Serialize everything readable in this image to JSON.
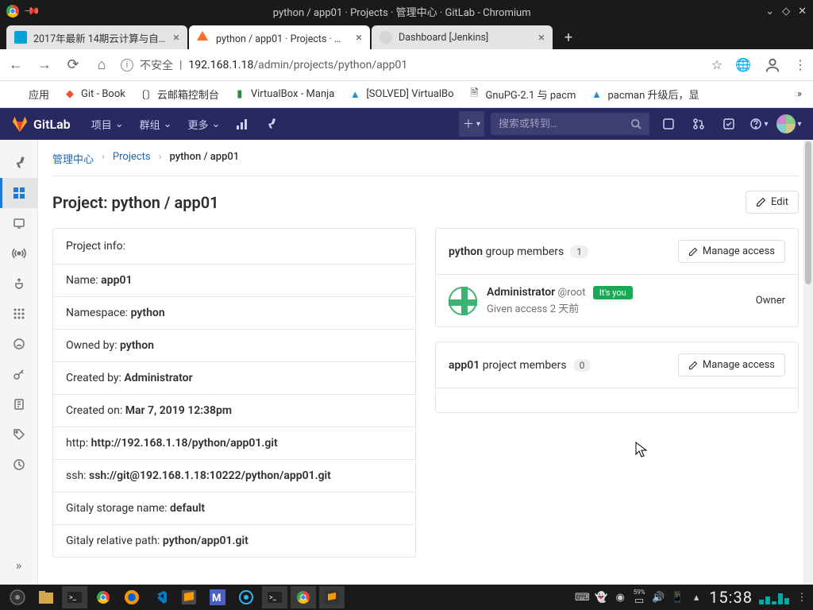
{
  "window": {
    "title": "python / app01 · Projects · 管理中心 · GitLab - Chromium"
  },
  "browser_tabs": [
    {
      "label": "2017年最新 14期云计算与自动",
      "active": false,
      "kind": "bili"
    },
    {
      "label": "python / app01 · Projects · 管理",
      "active": true,
      "kind": "gitlab"
    },
    {
      "label": "Dashboard [Jenkins]",
      "active": false,
      "kind": "jenkins"
    }
  ],
  "url": {
    "insecure_label": "不安全",
    "host": "192.168.1.18",
    "path": "/admin/projects/python/app01"
  },
  "bookmarks": [
    {
      "label": "应用",
      "icon": "apps"
    },
    {
      "label": "Git - Book",
      "icon": "git"
    },
    {
      "label": "云邮箱控制台",
      "icon": "mail"
    },
    {
      "label": "VirtualBox - Manja",
      "icon": "vbox"
    },
    {
      "label": "[SOLVED] VirtualBo",
      "icon": "arch"
    },
    {
      "label": "GnuPG-2.1 与 pacm",
      "icon": "doc"
    },
    {
      "label": "pacman 升级后，显",
      "icon": "arch"
    }
  ],
  "gitlab": {
    "brand": "GitLab",
    "menu": {
      "projects": "项目",
      "groups": "群组",
      "more": "更多"
    },
    "search_placeholder": "搜索或转到…"
  },
  "breadcrumb": {
    "admin": "管理中心",
    "projects": "Projects",
    "current": "python / app01"
  },
  "page": {
    "title": "Project: python / app01",
    "edit": "Edit"
  },
  "project_info": {
    "header": "Project info:",
    "name_label": "Name: ",
    "name": "app01",
    "ns_label": "Namespace: ",
    "ns": "python",
    "owned_label": "Owned by: ",
    "owned": "python",
    "cb_label": "Created by: ",
    "cb": "Administrator",
    "co_label": "Created on: ",
    "co": "Mar 7, 2019 12:38pm",
    "http_label": "http: ",
    "http": "http://192.168.1.18/python/app01.git",
    "ssh_label": "ssh: ",
    "ssh": "ssh://git@192.168.1.18:10222/python/app01.git",
    "gs_label": "Gitaly storage name: ",
    "gs": "default",
    "gr_label": "Gitaly relative path: ",
    "gr": "python/app01.git"
  },
  "group_members": {
    "strong": "python",
    "rest": " group members",
    "count": "1",
    "manage": "Manage access",
    "member": {
      "name": "Administrator",
      "handle": "@root",
      "its_you": "It's you",
      "given": "Given access 2 天前",
      "role": "Owner"
    }
  },
  "project_members": {
    "strong": "app01",
    "rest": " project members",
    "count": "0",
    "manage": "Manage access"
  },
  "taskbar": {
    "clock": "15:38",
    "battery": "59%"
  }
}
